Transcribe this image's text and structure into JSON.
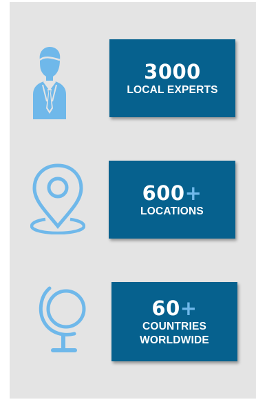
{
  "colors": {
    "panel_background": "#e4e4e4",
    "box_background": "#06618e",
    "icon_color": "#6fb8ea",
    "text_color": "#ffffff",
    "plus_color": "#6fb8ea"
  },
  "stats": [
    {
      "icon": "businessman-icon",
      "number": "3000",
      "plus": "",
      "label_line1": "LOCAL EXPERTS",
      "label_line2": ""
    },
    {
      "icon": "location-pin-icon",
      "number": "600",
      "plus": "+",
      "label_line1": "LOCATIONS",
      "label_line2": ""
    },
    {
      "icon": "globe-icon",
      "number": "60",
      "plus": "+",
      "label_line1": "COUNTRIES",
      "label_line2": "WORLDWIDE"
    }
  ]
}
